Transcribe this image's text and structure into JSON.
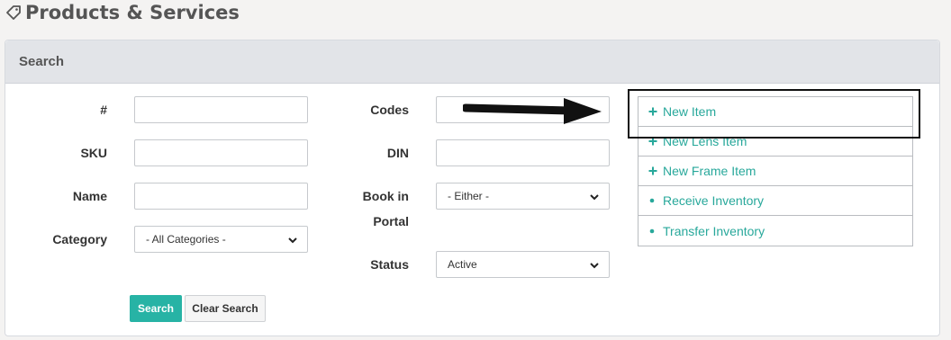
{
  "page": {
    "title": "Products & Services",
    "title_icon": "tag-icon"
  },
  "search_panel": {
    "header": "Search",
    "fields": {
      "number_label": "#",
      "number_value": "",
      "sku_label": "SKU",
      "sku_value": "",
      "name_label": "Name",
      "name_value": "",
      "category_label": "Category",
      "category_selected": "- All Categories -",
      "codes_label": "Codes",
      "codes_value": "",
      "din_label": "DIN",
      "din_value": "",
      "book_in_portal_label_line1": "Book in",
      "book_in_portal_label_line2": "Portal",
      "book_in_portal_selected": "- Either -",
      "status_label": "Status",
      "status_selected": "Active"
    },
    "buttons": {
      "search_label": "Search",
      "clear_label": "Clear Search"
    }
  },
  "actions_menu": {
    "items": [
      {
        "label": "New Item",
        "icon": "plus-icon"
      },
      {
        "label": "New Lens Item",
        "icon": "plus-icon"
      },
      {
        "label": "New Frame Item",
        "icon": "plus-icon"
      },
      {
        "label": "Receive Inventory",
        "icon": "bullet-icon"
      },
      {
        "label": "Transfer Inventory",
        "icon": "bullet-icon"
      }
    ]
  },
  "annotation": {
    "arrow_icon": "right-arrow-icon",
    "highlight_color": "#111111"
  },
  "colors": {
    "accent": "#27b3a5",
    "link": "#28a89b",
    "header_bg": "#e2e4e8",
    "page_bg": "#f4f3f2"
  }
}
